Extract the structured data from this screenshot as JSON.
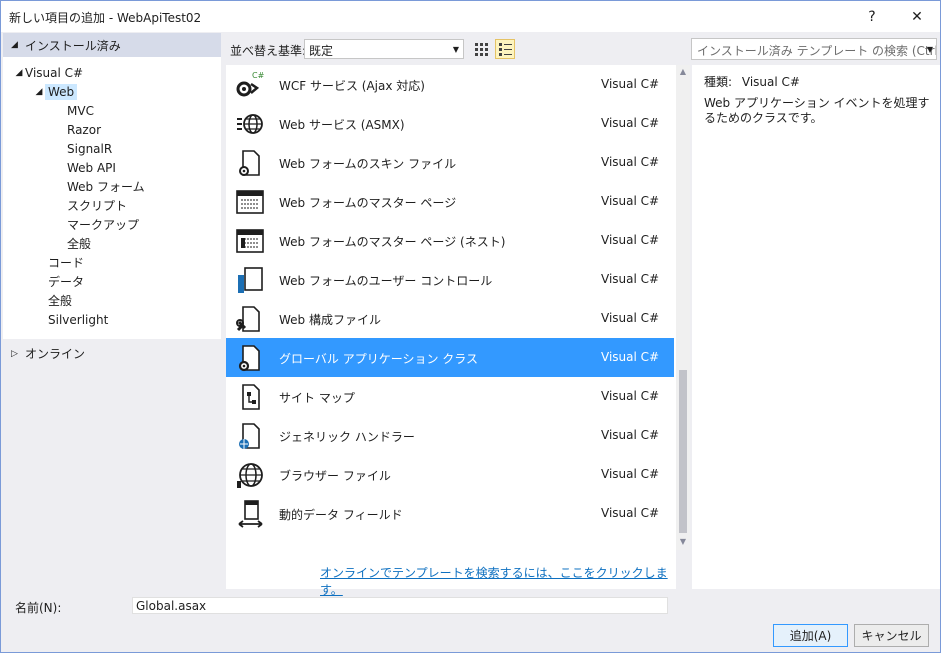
{
  "window": {
    "title": "新しい項目の追加 - WebApiTest02",
    "help_label": "?",
    "close_label": "✕"
  },
  "sidebar": {
    "installed_label": "インストール済み",
    "online_label": "オンライン",
    "tree": [
      {
        "label": "Visual C#",
        "arrow": "◢"
      },
      {
        "label": "Web",
        "arrow": "◢"
      },
      {
        "label": "MVC"
      },
      {
        "label": "Razor"
      },
      {
        "label": "SignalR"
      },
      {
        "label": "Web API"
      },
      {
        "label": "Web フォーム"
      },
      {
        "label": "スクリプト"
      },
      {
        "label": "マークアップ"
      },
      {
        "label": "全般"
      },
      {
        "label": "コード"
      },
      {
        "label": "データ"
      },
      {
        "label": "全般"
      },
      {
        "label": "Silverlight"
      }
    ]
  },
  "toolbar": {
    "sort_label": "並べ替え基準:",
    "sort_value": "既定",
    "search_placeholder": "インストール済み テンプレート の検索 (Ctrl+E"
  },
  "templates": [
    {
      "name": "WCF サービス (Ajax 対応)",
      "lang": "Visual C#",
      "icon": "wcf-service-icon"
    },
    {
      "name": "Web サービス (ASMX)",
      "lang": "Visual C#",
      "icon": "web-service-icon"
    },
    {
      "name": "Web フォームのスキン ファイル",
      "lang": "Visual C#",
      "icon": "skin-file-icon"
    },
    {
      "name": "Web フォームのマスター ページ",
      "lang": "Visual C#",
      "icon": "master-page-icon"
    },
    {
      "name": "Web フォームのマスター ページ (ネスト)",
      "lang": "Visual C#",
      "icon": "nested-master-page-icon"
    },
    {
      "name": "Web フォームのユーザー コントロール",
      "lang": "Visual C#",
      "icon": "user-control-icon"
    },
    {
      "name": "Web 構成ファイル",
      "lang": "Visual C#",
      "icon": "config-file-icon"
    },
    {
      "name": "グローバル アプリケーション クラス",
      "lang": "Visual C#",
      "icon": "global-app-class-icon"
    },
    {
      "name": "サイト マップ",
      "lang": "Visual C#",
      "icon": "sitemap-icon"
    },
    {
      "name": "ジェネリック ハンドラー",
      "lang": "Visual C#",
      "icon": "generic-handler-icon"
    },
    {
      "name": "ブラウザー ファイル",
      "lang": "Visual C#",
      "icon": "browser-file-icon"
    },
    {
      "name": "動的データ フィールド",
      "lang": "Visual C#",
      "icon": "dynamic-data-field-icon"
    }
  ],
  "selected_template_index": 7,
  "online_link": "オンラインでテンプレートを検索するには、ここをクリックします。",
  "details": {
    "type_label": "種類:",
    "type_value": "Visual C#",
    "description": "Web アプリケーション イベントを処理するためのクラスです。"
  },
  "name_field": {
    "label": "名前(N):",
    "value": "Global.asax"
  },
  "buttons": {
    "add": "追加(A)",
    "cancel": "キャンセル"
  },
  "colors": {
    "selection": "#3399ff",
    "link": "#0e70c0",
    "tree_selection": "#cce8ff"
  }
}
